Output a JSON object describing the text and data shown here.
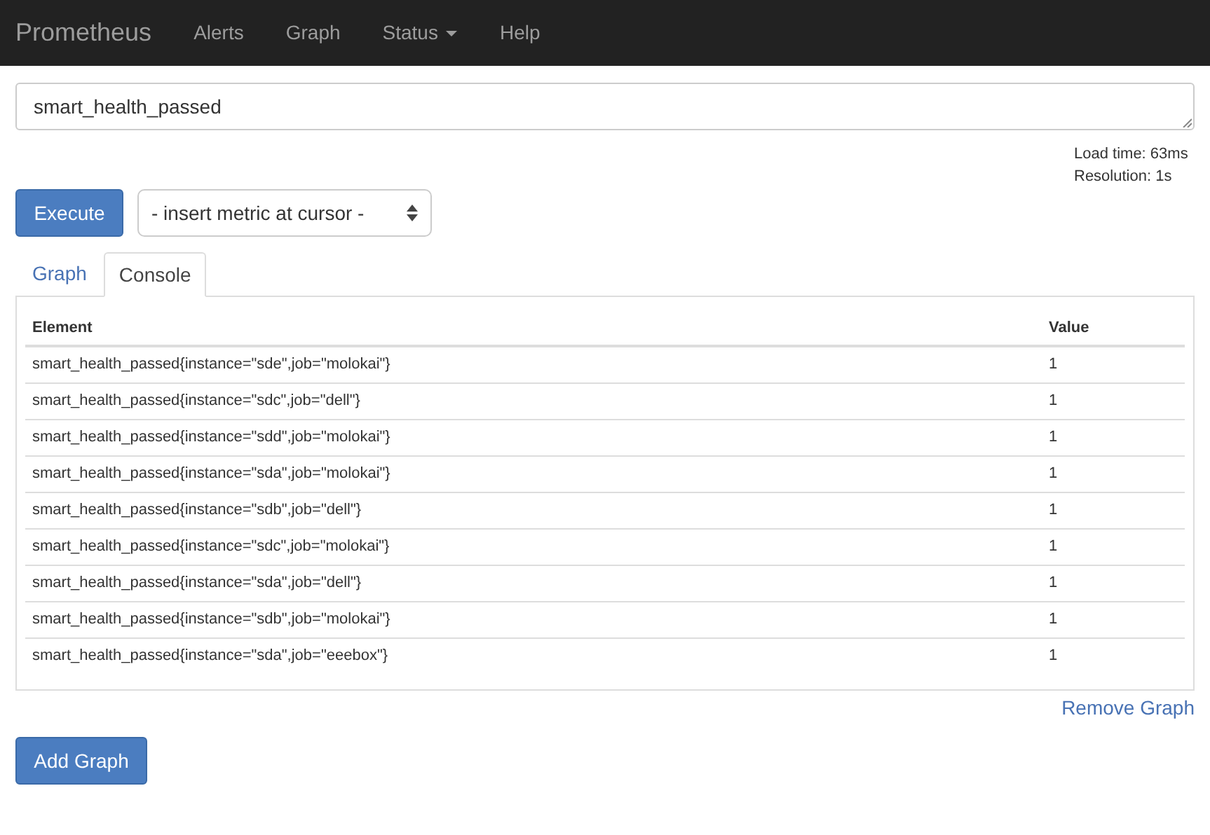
{
  "navbar": {
    "brand": "Prometheus",
    "items": [
      {
        "label": "Alerts",
        "dropdown": false
      },
      {
        "label": "Graph",
        "dropdown": false
      },
      {
        "label": "Status",
        "dropdown": true
      },
      {
        "label": "Help",
        "dropdown": false
      }
    ]
  },
  "expression": {
    "value": "smart_health_passed"
  },
  "stats": [
    "Load time: 63ms",
    "Resolution: 1s"
  ],
  "execute_button": "Execute",
  "metric_select": {
    "value": "- insert metric at cursor -"
  },
  "tabs": [
    {
      "label": "Graph",
      "selected": false
    },
    {
      "label": "Console",
      "selected": true
    }
  ],
  "table": {
    "columns": [
      "Element",
      "Value"
    ],
    "rows": [
      [
        "smart_health_passed{instance=\"sde\",job=\"molokai\"}",
        "1"
      ],
      [
        "smart_health_passed{instance=\"sdc\",job=\"dell\"}",
        "1"
      ],
      [
        "smart_health_passed{instance=\"sdd\",job=\"molokai\"}",
        "1"
      ],
      [
        "smart_health_passed{instance=\"sda\",job=\"molokai\"}",
        "1"
      ],
      [
        "smart_health_passed{instance=\"sdb\",job=\"dell\"}",
        "1"
      ],
      [
        "smart_health_passed{instance=\"sdc\",job=\"molokai\"}",
        "1"
      ],
      [
        "smart_health_passed{instance=\"sda\",job=\"dell\"}",
        "1"
      ],
      [
        "smart_health_passed{instance=\"sdb\",job=\"molokai\"}",
        "1"
      ],
      [
        "smart_health_passed{instance=\"sda\",job=\"eeebox\"}",
        "1"
      ]
    ]
  },
  "remove_link": "Remove Graph",
  "add_button": "Add Graph"
}
